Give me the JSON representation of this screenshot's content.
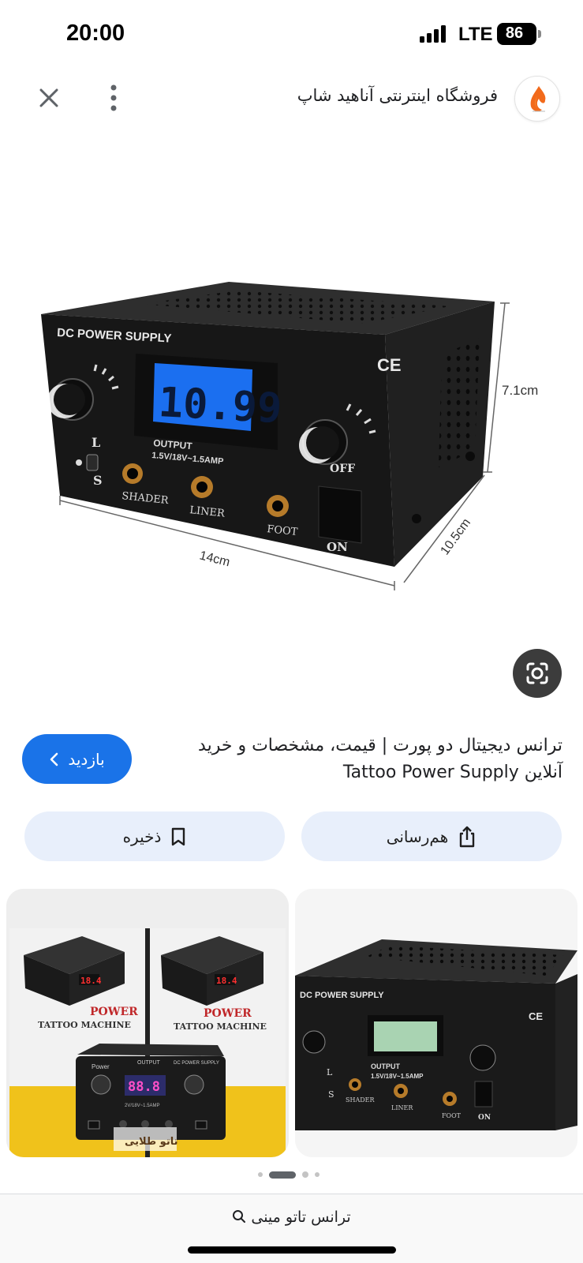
{
  "status_bar": {
    "time": "20:00",
    "network": "LTE",
    "battery": "86"
  },
  "header": {
    "site_name": "فروشگاه اینترنتی آناهید شاپ"
  },
  "product": {
    "brand_label": "DC POWER SUPPLY",
    "display_value": "10.99",
    "ce_mark": "CE",
    "output_label": "OUTPUT",
    "output_spec": "1.5V/18V~1.5AMP",
    "switch_top": "L",
    "switch_bottom": "S",
    "ports": [
      "SHADER",
      "LINER",
      "FOOT"
    ],
    "power_off": "OFF",
    "power_on": "ON",
    "dim_width": "14cm",
    "dim_depth": "10.5cm",
    "dim_height": "7.1cm"
  },
  "result": {
    "title_line1": "ترانس دیجیتال دو پورت | قیمت، مشخصات و خرید",
    "title_line2": "آنلاین Tattoo Power Supply",
    "visit_label": "بازدید"
  },
  "actions": {
    "save_label": "ذخیره",
    "share_label": "هم‌رسانی"
  },
  "thumb1": {
    "box_text1": "POWER",
    "box_text2": "TATTOO MACHINE",
    "device_left": "Power",
    "device_mid": "OUTPUT",
    "device_right": "DC POWER SUPPLY",
    "display": "18.4",
    "display2": "88.8",
    "spec": "2V/18V~1.5AMP",
    "watermark": "تاتو طلایی"
  },
  "thumb2": {
    "brand_label": "DC POWER SUPPLY",
    "ce_mark": "CE",
    "output_label": "OUTPUT",
    "output_spec": "1.5V/18V~1.5AMP",
    "ports": [
      "SHADER",
      "LINER",
      "FOOT"
    ],
    "switch_top": "L",
    "switch_bottom": "S",
    "power_on": "ON"
  },
  "bottom": {
    "search_text": "ترانس تاتو مینی"
  },
  "colors": {
    "accent": "#1a73e8",
    "chip_bg": "#e8effb",
    "display_blue": "#1b6ff0"
  }
}
